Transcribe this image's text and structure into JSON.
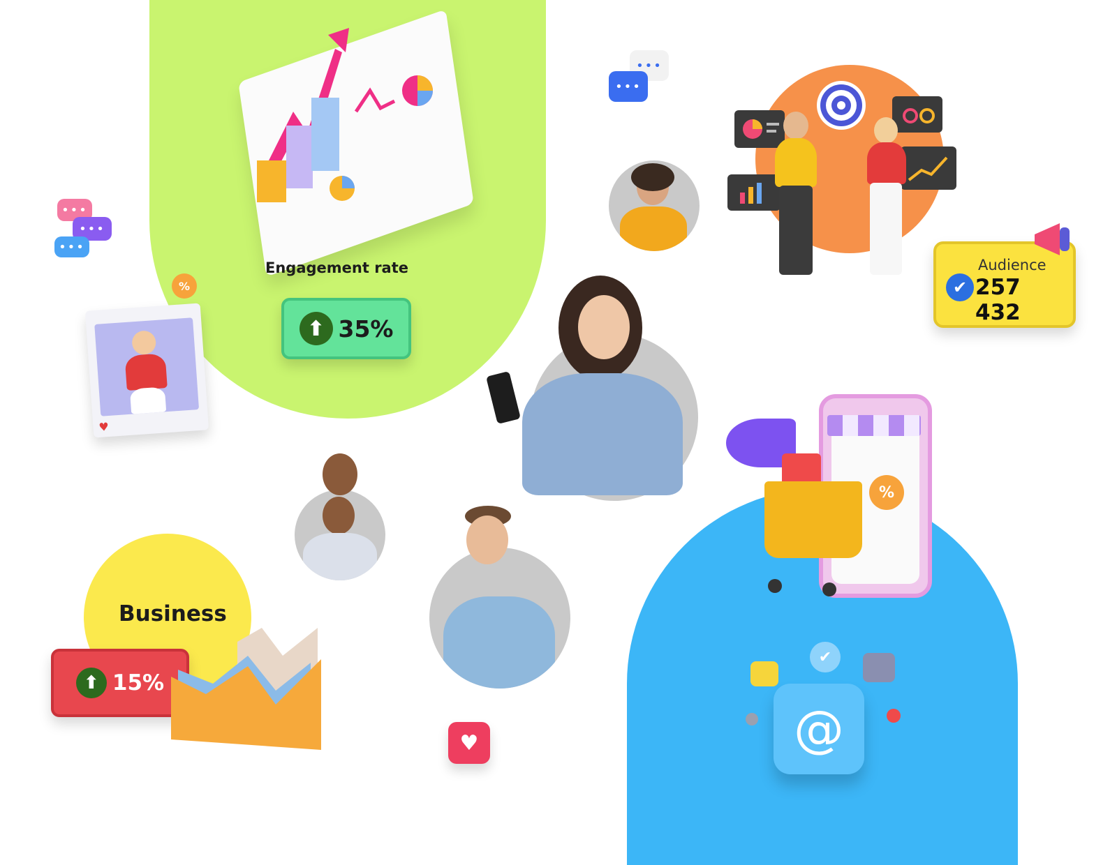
{
  "engagement": {
    "label": "Engagement rate",
    "value": "35%"
  },
  "business": {
    "label": "Business",
    "value": "15%"
  },
  "audience": {
    "label": "Audience",
    "value": "257 432"
  },
  "icons": {
    "up_arrow": "⬆",
    "verified": "✔",
    "heart": "♥",
    "at": "@",
    "dots": "•••",
    "percent": "%"
  },
  "colors": {
    "green_blob": "#c9f46f",
    "blue_blob": "#3cb6f7",
    "yellow_circle": "#fbe94d",
    "orange_circle": "#f6914a",
    "green_pill": "#63e39a",
    "red_pill": "#e8474e",
    "audience_card": "#fbe23f"
  }
}
